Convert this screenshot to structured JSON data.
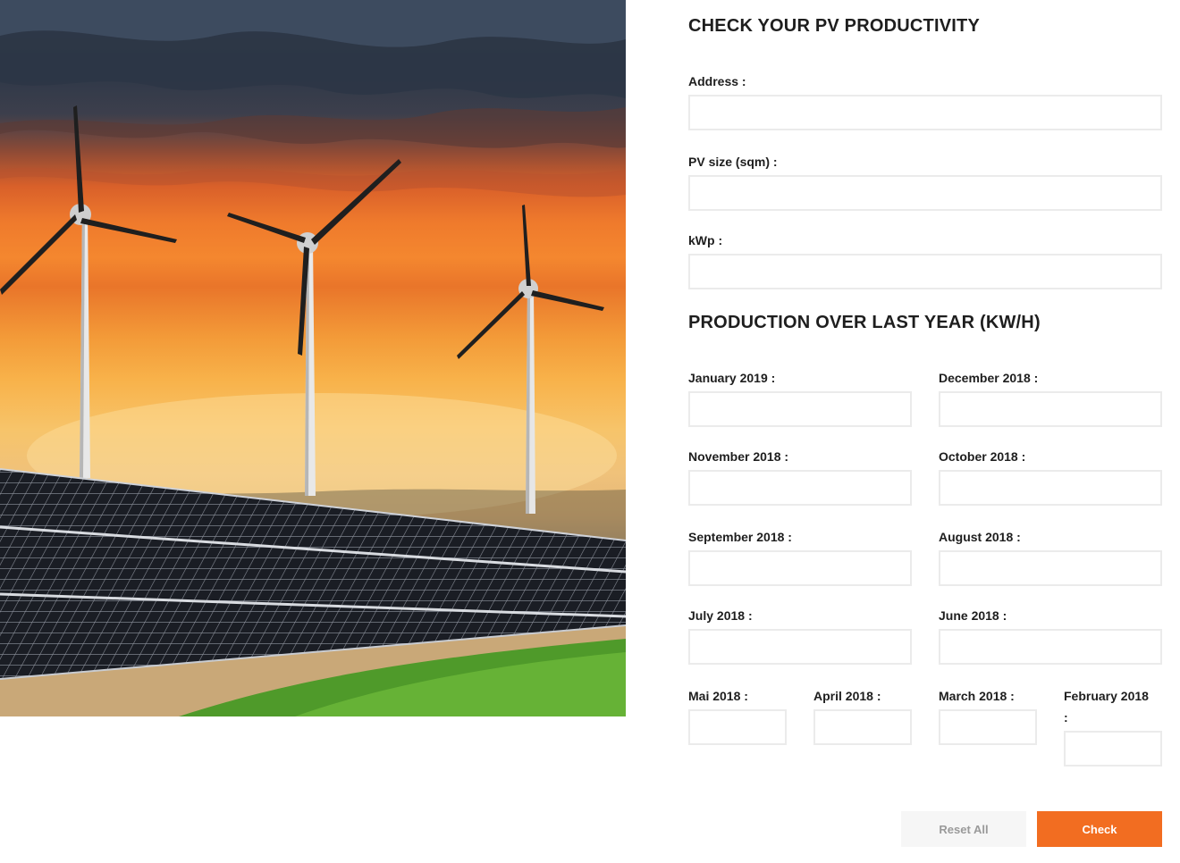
{
  "hero": {
    "image": "Wind turbines and solar panels at sunset"
  },
  "form": {
    "title": "CHECK YOUR PV PRODUCTIVITY",
    "address_label": "Address :",
    "pv_size_label": "PV size (sqm) :",
    "kwp_label": "kWp :",
    "production_title": "PRODUCTION OVER LAST YEAR (KW/H)",
    "months": {
      "jan_2019": "January 2019 :",
      "dec_2018": "December 2018 :",
      "nov_2018": "November 2018 :",
      "oct_2018": "October 2018 :",
      "sep_2018": "September 2018 :",
      "aug_2018": "August 2018 :",
      "jul_2018": "July 2018 :",
      "jun_2018": "June 2018 :",
      "mai_2018": "Mai 2018 :",
      "apr_2018": "April 2018 :",
      "mar_2018": "March 2018 :",
      "feb_2018_line1": "February 2018",
      "feb_2018_line2": ":"
    },
    "values": {
      "address": "",
      "pv_size": "",
      "kwp": "",
      "jan_2019": "",
      "dec_2018": "",
      "nov_2018": "",
      "oct_2018": "",
      "sep_2018": "",
      "aug_2018": "",
      "jul_2018": "",
      "jun_2018": "",
      "mai_2018": "",
      "apr_2018": "",
      "mar_2018": "",
      "feb_2018": ""
    },
    "buttons": {
      "reset": "Reset All",
      "check": "Check"
    }
  },
  "colors": {
    "accent": "#f26d21",
    "input_border": "#ebebeb",
    "reset_bg": "#f6f6f6"
  }
}
